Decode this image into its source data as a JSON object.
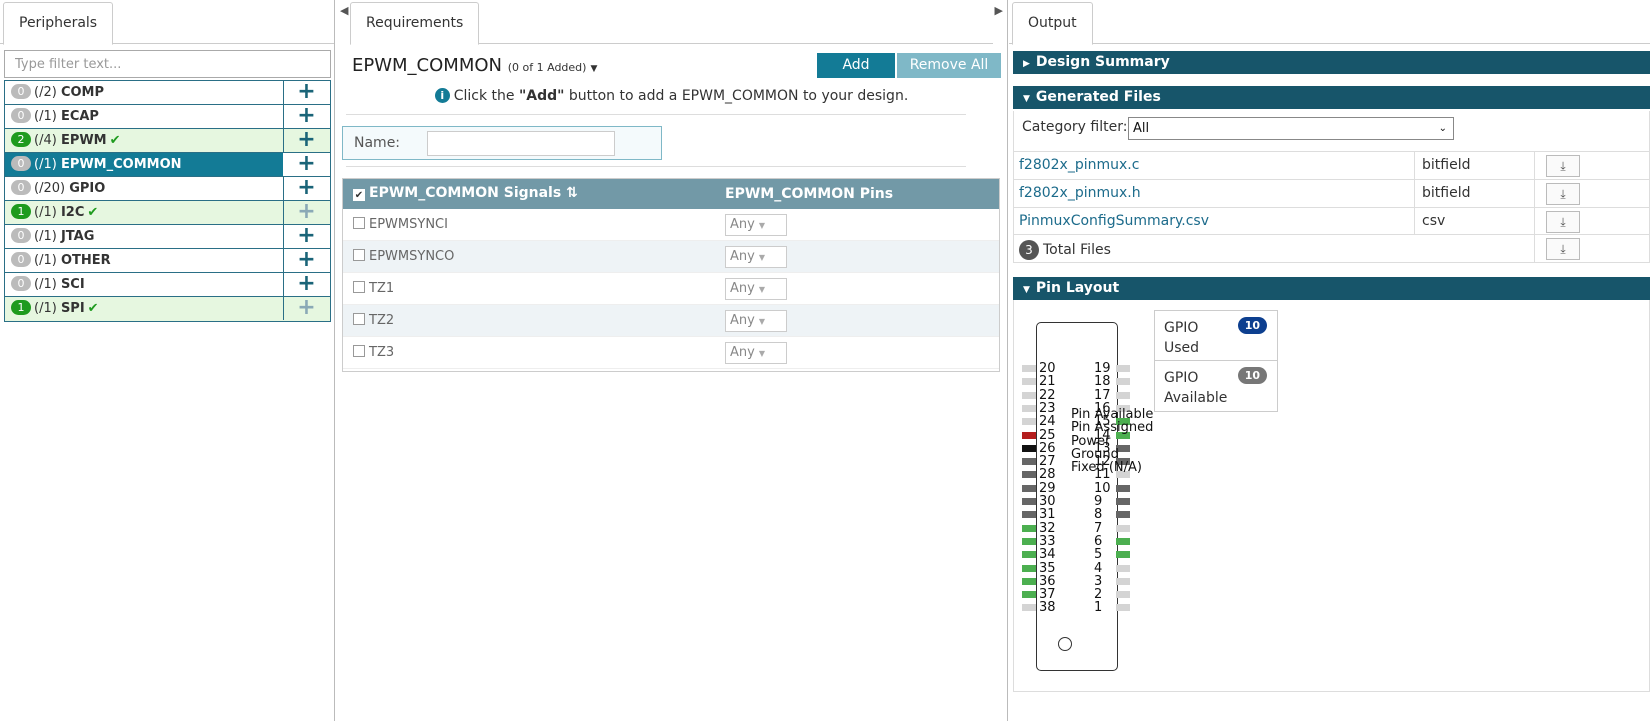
{
  "peripherals": {
    "tab_label": "Peripherals",
    "filter_placeholder": "Type filter text...",
    "items": [
      {
        "badge": "0",
        "count": "(/2)",
        "name": "COMP",
        "checked": false
      },
      {
        "badge": "0",
        "count": "(/1)",
        "name": "ECAP",
        "checked": false
      },
      {
        "badge": "2",
        "count": "(/4)",
        "name": "EPWM",
        "checked": true
      },
      {
        "badge": "0",
        "count": "(/1)",
        "name": "EPWM_COMMON",
        "checked": false
      },
      {
        "badge": "0",
        "count": "(/20)",
        "name": "GPIO",
        "checked": false
      },
      {
        "badge": "1",
        "count": "(/1)",
        "name": "I2C",
        "checked": true
      },
      {
        "badge": "0",
        "count": "(/1)",
        "name": "JTAG",
        "checked": false
      },
      {
        "badge": "0",
        "count": "(/1)",
        "name": "OTHER",
        "checked": false
      },
      {
        "badge": "0",
        "count": "(/1)",
        "name": "SCI",
        "checked": false
      },
      {
        "badge": "1",
        "count": "(/1)",
        "name": "SPI",
        "checked": true
      }
    ],
    "plus_glyph": "+",
    "check_glyph": "✔"
  },
  "requirements": {
    "tab_label": "Requirements",
    "title": "EPWM_COMMON",
    "added_count": "(0 of 1 Added)",
    "add_label": "Add",
    "remove_all_label": "Remove All",
    "info_pre": "Click the ",
    "info_bold": "\"Add\"",
    "info_post": " button to add a EPWM_COMMON to your design.",
    "name_label": "Name:",
    "signals_header": "EPWM_COMMON Signals",
    "pins_header": "EPWM_COMMON Pins",
    "signals": [
      {
        "name": "EPWMSYNCI",
        "pin": "Any"
      },
      {
        "name": "EPWMSYNCO",
        "pin": "Any"
      },
      {
        "name": "TZ1",
        "pin": "Any"
      },
      {
        "name": "TZ2",
        "pin": "Any"
      },
      {
        "name": "TZ3",
        "pin": "Any"
      }
    ]
  },
  "output": {
    "tab_label": "Output",
    "design_summary": "Design Summary",
    "generated_files": "Generated Files",
    "category_label": "Category filter:",
    "category_value": "All",
    "files": [
      {
        "name": "f2802x_pinmux.c",
        "type": "bitfield"
      },
      {
        "name": "f2802x_pinmux.h",
        "type": "bitfield"
      },
      {
        "name": "PinmuxConfigSummary.csv",
        "type": "csv"
      }
    ],
    "total_count": "3",
    "total_label": "Total Files",
    "download_glyph": "⤓",
    "pin_layout": "Pin Layout",
    "pins_left": [
      "20",
      "21",
      "22",
      "23",
      "24",
      "25",
      "26",
      "27",
      "28",
      "29",
      "30",
      "31",
      "32",
      "33",
      "34",
      "35",
      "36",
      "37",
      "38"
    ],
    "pins_right": [
      "19",
      "18",
      "17",
      "16",
      "15",
      "14",
      "13",
      "12",
      "11",
      "10",
      "9",
      "8",
      "7",
      "6",
      "5",
      "4",
      "3",
      "2",
      "1"
    ],
    "legend": [
      "Pin Available",
      "Pin Assigned",
      "Power",
      "Ground",
      "Fixed (N/A)"
    ],
    "gpio_used_label": "GPIO Used",
    "gpio_used_count": "10",
    "gpio_avail_label": "GPIO Available",
    "gpio_avail_count": "10",
    "colors": {
      "available": "#d4d4d4",
      "assigned": "#4caf50",
      "power": "#b41e1e",
      "ground": "#111111",
      "fixed": "#666666"
    }
  }
}
